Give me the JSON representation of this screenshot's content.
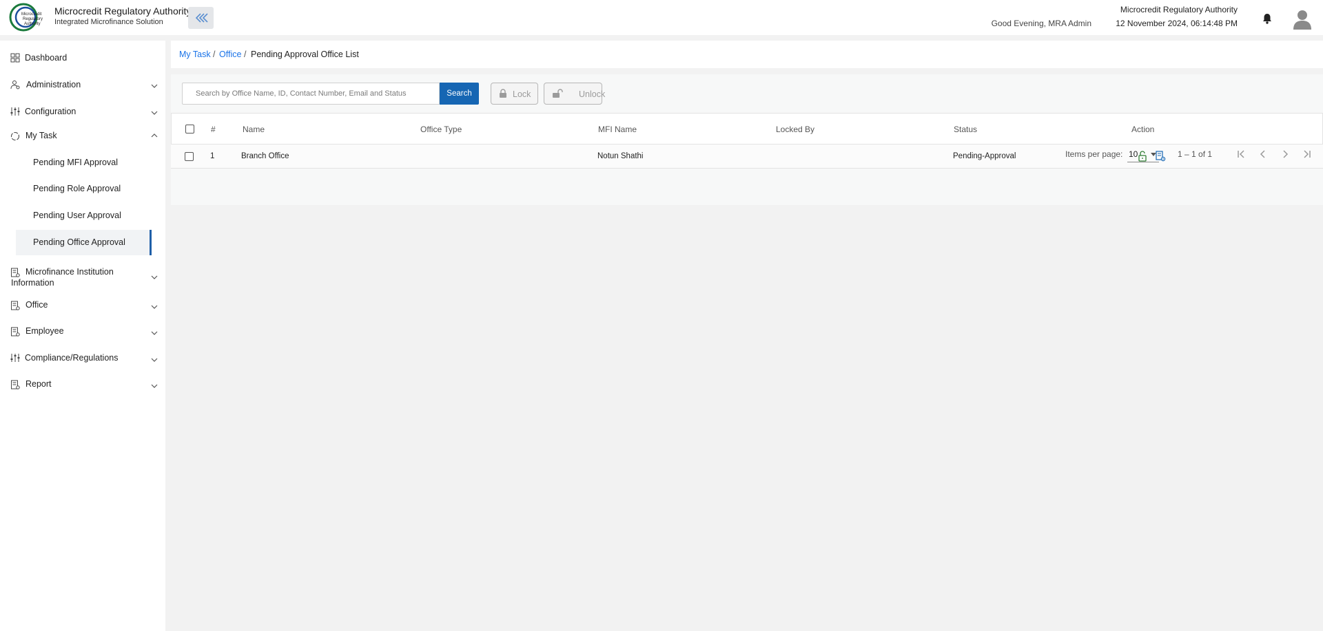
{
  "header": {
    "brand_title": "Microcredit Regulatory Authority",
    "brand_subtitle": "Integrated Microfinance Solution",
    "logo_text_lines": [
      "Microcredit",
      "Regulatory",
      "Authority"
    ],
    "greeting": "Good Evening, MRA Admin",
    "org_name": "Microcredit Regulatory Authority",
    "datetime": "12 November 2024, 06:14:48 PM",
    "icons": [
      "double-chevron-left-icon",
      "bell-icon",
      "user-avatar-icon"
    ]
  },
  "sidebar": {
    "items": [
      {
        "label": "Dashboard",
        "icon": "grid-icon",
        "expandable": false
      },
      {
        "label": "Administration",
        "icon": "users-cog-icon",
        "expandable": true
      },
      {
        "label": "Configuration",
        "icon": "sliders-icon",
        "expandable": true
      },
      {
        "label": "My Task",
        "icon": "circle-dashed-icon",
        "expandable": true,
        "expanded": true
      },
      {
        "label": "Microfinance Institution Information",
        "icon": "document-icon",
        "expandable": true
      },
      {
        "label": "Office",
        "icon": "document-icon",
        "expandable": true
      },
      {
        "label": "Employee",
        "icon": "document-icon",
        "expandable": true
      },
      {
        "label": "Compliance/Regulations",
        "icon": "sliders-icon",
        "expandable": true
      },
      {
        "label": "Report",
        "icon": "document-icon",
        "expandable": true
      }
    ],
    "mytask_subitems": [
      {
        "label": "Pending MFI Approval"
      },
      {
        "label": "Pending Role Approval"
      },
      {
        "label": "Pending User Approval"
      },
      {
        "label": "Pending Office Approval",
        "active": true
      }
    ]
  },
  "breadcrumb": {
    "items": [
      "My Task",
      "Office",
      "Pending Approval Office List"
    ],
    "separator": "/"
  },
  "toolbar": {
    "search_placeholder": "Search by Office Name, ID, Contact Number, Email and Status",
    "search_value": "",
    "search_label": "Search",
    "lock_label": "Lock",
    "unlock_label": "Unlock"
  },
  "table": {
    "columns": [
      "#",
      "Name",
      "Office Type",
      "MFI Name",
      "Locked By",
      "Status",
      "Action"
    ],
    "rows": [
      {
        "index": "1",
        "name": "Branch Office",
        "office_type": "",
        "mfi_name": "Notun Shathi",
        "locked_by": "",
        "status": "Pending-Approval",
        "actions": [
          "unlock-icon",
          "view-document-icon"
        ]
      }
    ]
  },
  "paginator": {
    "items_per_page_label": "Items per page:",
    "items_per_page_value": "10",
    "range_label": "1 – 1 of 1"
  },
  "colors": {
    "primary": "#1666b3",
    "link": "#1a73e8",
    "active_indicator": "#1f5fa8",
    "unlock_icon": "#2e7d32",
    "background": "#f2f2f2"
  }
}
